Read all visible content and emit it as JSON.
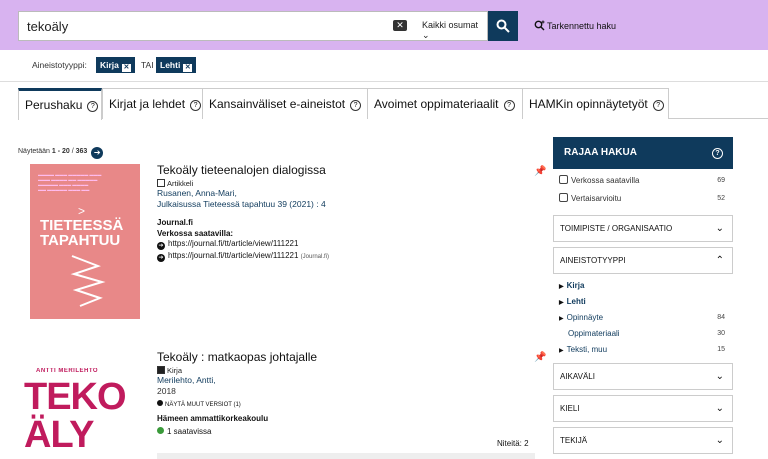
{
  "search": {
    "query": "tekoäly",
    "scope": "Kaikki osumat",
    "scope_chevron": "⌄",
    "clear_icon": "close-icon",
    "search_icon": "search-icon",
    "advanced": "Tarkennettu haku"
  },
  "filters": {
    "label": "Aineistotyyppi:",
    "chips": [
      "Kirja",
      "Lehti"
    ],
    "operator": "TAI"
  },
  "tabs": [
    "Perushaku",
    "Kirjat ja lehdet",
    "Kansainväliset e-aineistot",
    "Avoimet oppimateriaalit",
    "HAMKin opinnäytetyöt"
  ],
  "count": {
    "prefix": "Näytetään ",
    "range": "1 - 20",
    "separator": " / ",
    "total": "363"
  },
  "results": [
    {
      "title": "Tekoäly tieteenalojen dialogissa",
      "type": "Artikkeli",
      "authors": "Rusanen, Anna-Mari,",
      "source": "Julkaisussa Tieteessä tapahtuu 39 (2021) : 4",
      "publisher": "Journal.fi",
      "availability_heading": "Verkossa saatavilla:",
      "links": [
        {
          "url": "https://journal.fi/tt/article/view/111221",
          "note": ""
        },
        {
          "url": "https://journal.fi/tt/article/view/111221",
          "note": "(Journal.fi)"
        }
      ],
      "cover": {
        "text": "TIETEESSÄ TAPAHTUU",
        "color": "#e88888"
      }
    },
    {
      "title": "Tekoäly : matkaopas johtajalle",
      "type": "Kirja",
      "authors": "Merilehto, Antti,",
      "year": "2018",
      "other_versions": "NÄYTÄ MUUT VERSIOT (1)",
      "library": "Hämeen ammattikorkeakoulu",
      "availability": "1 saatavissa",
      "copies": "Niteitä: 2",
      "cover": {
        "author": "ANTTI MERILEHTO",
        "text": "TEKO ÄLY",
        "color": "#c01b5d"
      }
    }
  ],
  "sidebar": {
    "heading": "RAJAA HAKUA",
    "checkboxes": [
      {
        "label": "Verkossa saatavilla",
        "count": "69"
      },
      {
        "label": "Vertaisarvioitu",
        "count": "52"
      }
    ],
    "facets": {
      "organisation": "TOIMIPISTE / ORGANISAATIO",
      "type": "AINEISTOTYYPPI",
      "period": "AIKAVÄLI",
      "language": "KIELI",
      "author": "TEKIJÄ"
    },
    "type_items": [
      {
        "label": "Kirja",
        "count": ""
      },
      {
        "label": "Lehti",
        "count": ""
      },
      {
        "label": "Opinnäyte",
        "count": "84"
      },
      {
        "label": "Oppimateriaali",
        "count": "30"
      },
      {
        "label": "Teksti, muu",
        "count": "15"
      }
    ]
  },
  "colors": {
    "topbar": "#d8b3f0",
    "primary": "#0f3a5c",
    "available": "#3a9a3a"
  }
}
